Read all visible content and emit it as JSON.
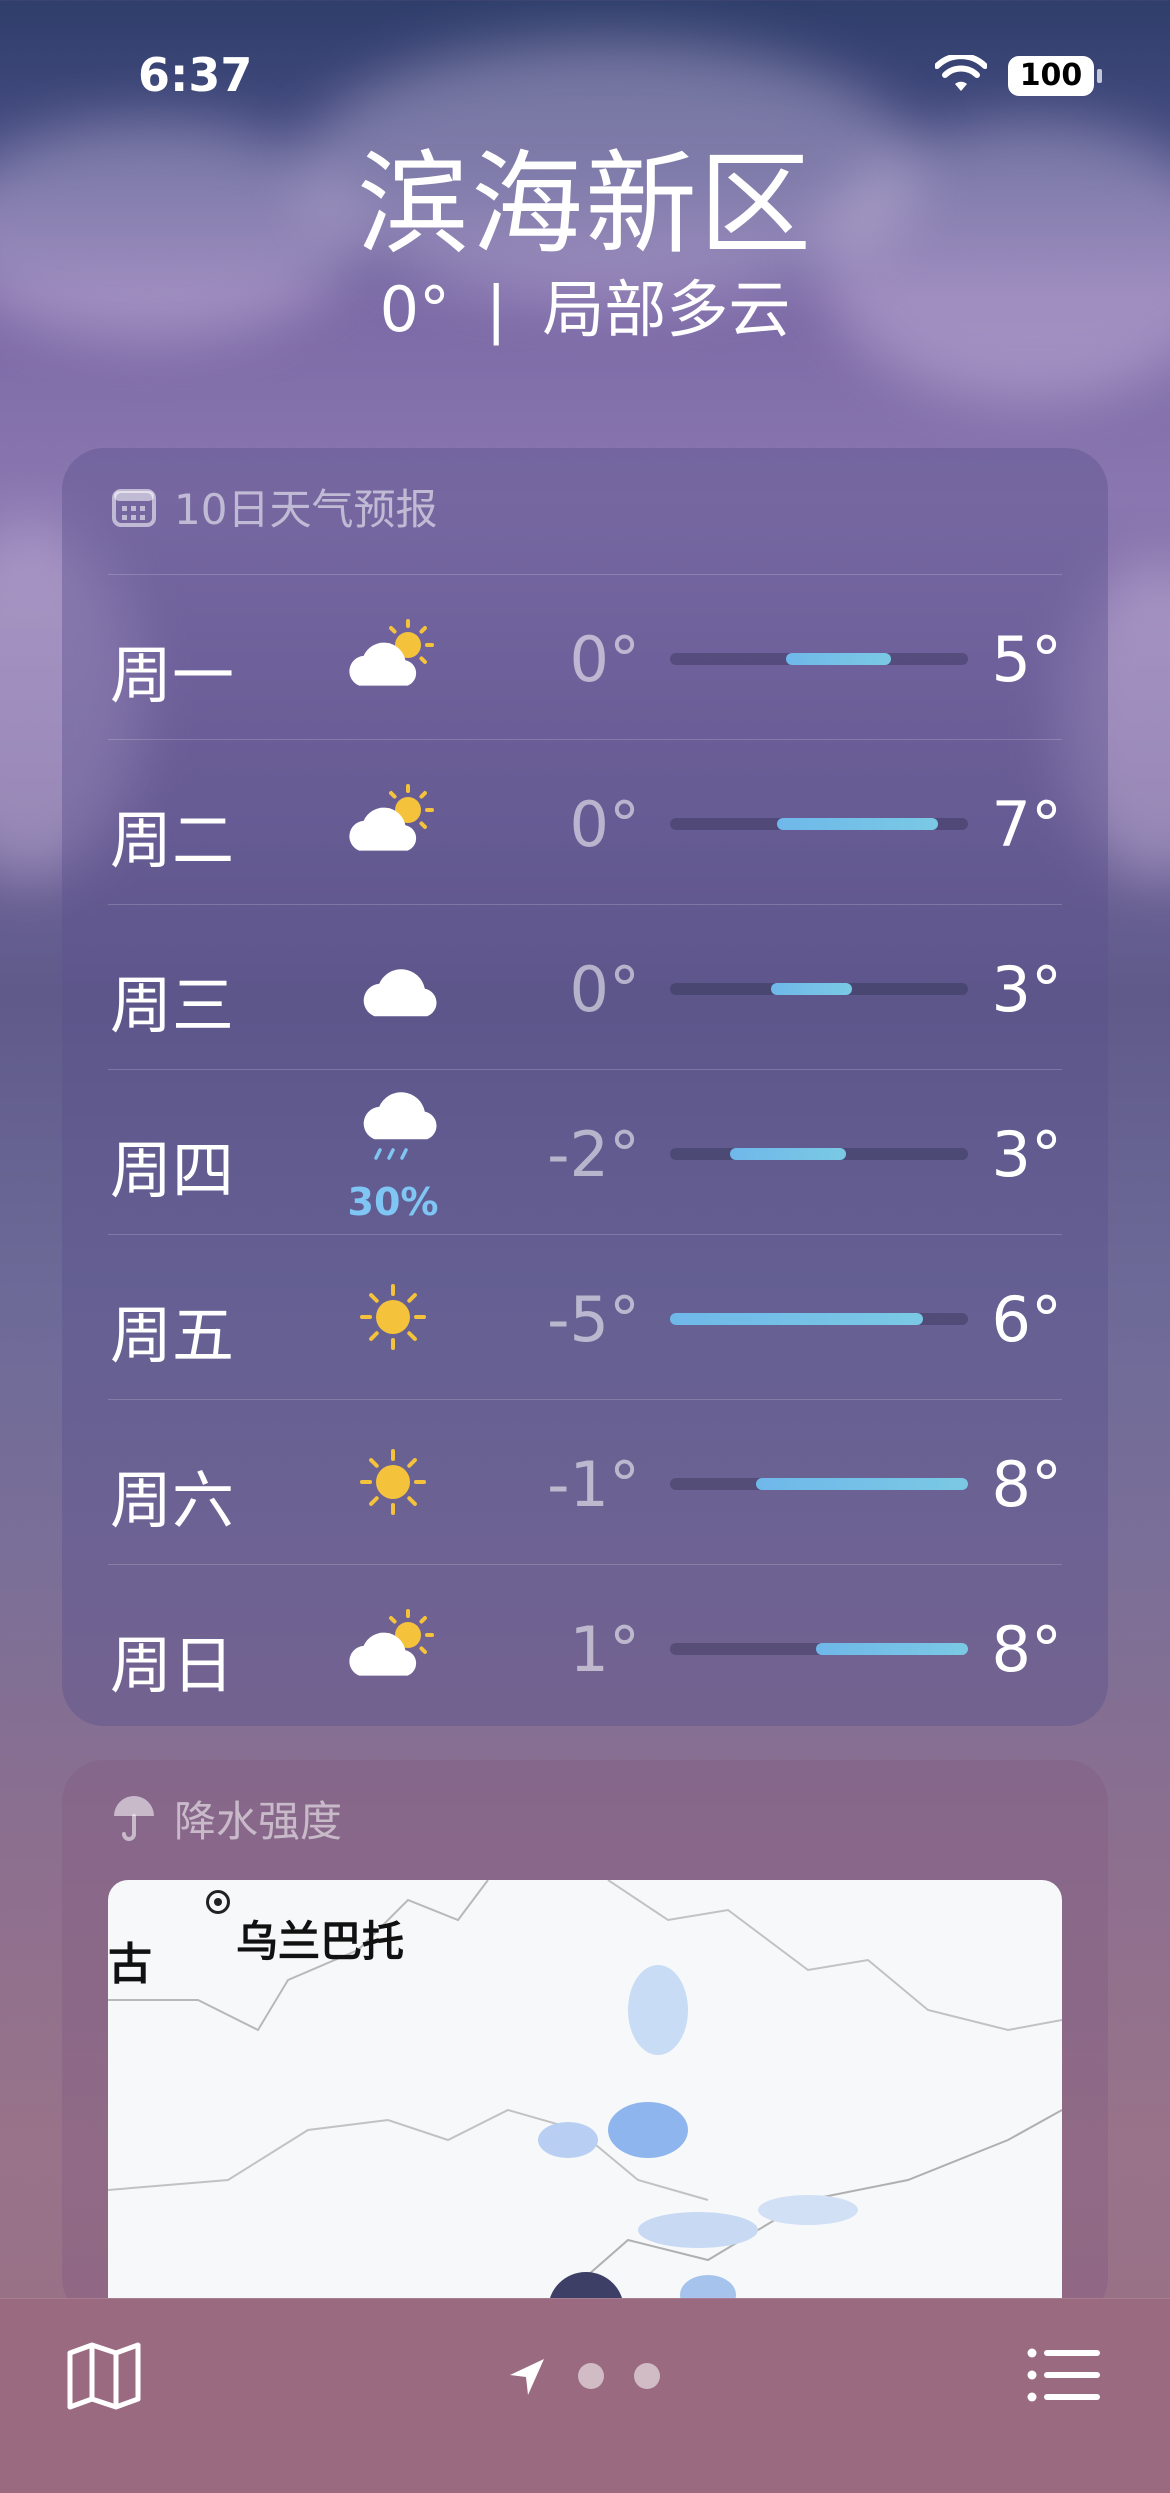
{
  "status_bar": {
    "time": "6:37",
    "battery": "100"
  },
  "header": {
    "city": "滨海新区",
    "temp": "0°",
    "separator": "|",
    "condition": "局部多云"
  },
  "forecast": {
    "title": "10日天气预报",
    "days": [
      {
        "day": "周一",
        "icon": "partly-sunny-icon",
        "low": "0°",
        "high": "5°",
        "precip": "",
        "range_start": 0.39,
        "range_end": 0.74
      },
      {
        "day": "周二",
        "icon": "partly-sunny-icon",
        "low": "0°",
        "high": "7°",
        "precip": "",
        "range_start": 0.36,
        "range_end": 0.9
      },
      {
        "day": "周三",
        "icon": "cloud-icon",
        "low": "0°",
        "high": "3°",
        "precip": "",
        "range_start": 0.34,
        "range_end": 0.61
      },
      {
        "day": "周四",
        "icon": "rain-icon",
        "low": "-2°",
        "high": "3°",
        "precip": "30%",
        "range_start": 0.2,
        "range_end": 0.59
      },
      {
        "day": "周五",
        "icon": "sun-icon",
        "low": "-5°",
        "high": "6°",
        "precip": "",
        "range_start": 0.0,
        "range_end": 0.85
      },
      {
        "day": "周六",
        "icon": "sun-icon",
        "low": "-1°",
        "high": "8°",
        "precip": "",
        "range_start": 0.29,
        "range_end": 1.0
      },
      {
        "day": "周日",
        "icon": "partly-sunny-icon",
        "low": "1°",
        "high": "8°",
        "precip": "",
        "range_start": 0.49,
        "range_end": 1.0
      }
    ]
  },
  "precipitation": {
    "title": "降水强度",
    "map_labels": [
      "乌兰巴托",
      "古"
    ]
  },
  "tabbar": {
    "map_icon": "map-icon",
    "location_icon": "location-arrow-icon",
    "list_icon": "list-icon",
    "page_dots": 2
  },
  "colors": {
    "bar_fill": "#6fb8ea",
    "precip_text": "#7fc6f5",
    "sun": "#f5c33b"
  }
}
